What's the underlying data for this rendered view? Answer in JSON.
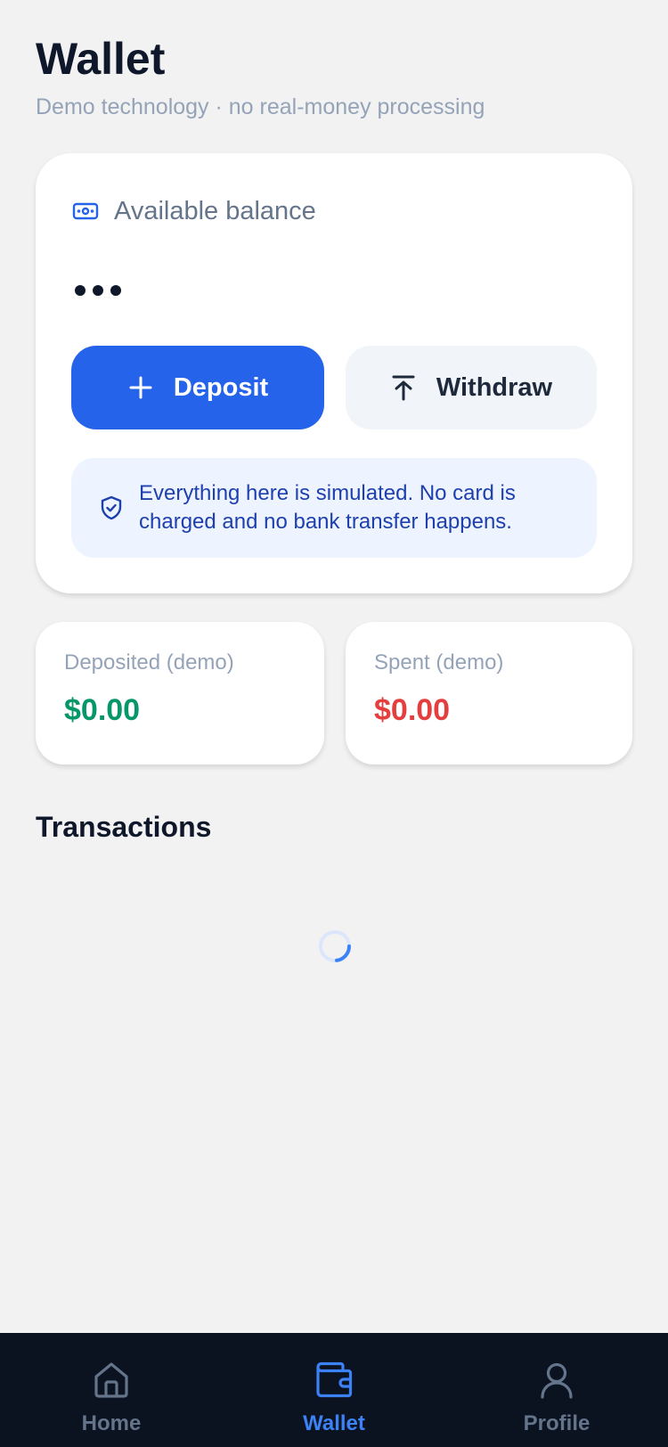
{
  "header": {
    "title": "Wallet",
    "subtitle": "Demo technology · no real-money processing"
  },
  "balance": {
    "label": "Available balance",
    "icon": "cash-icon",
    "value_state": "loading"
  },
  "actions": {
    "deposit_label": "Deposit",
    "withdraw_label": "Withdraw"
  },
  "notice": {
    "icon": "shield-check-icon",
    "text": "Everything here is simulated. No card is charged and no bank transfer happens."
  },
  "stats": {
    "deposited_label": "Deposited (demo)",
    "deposited_value": "$0.00",
    "spent_label": "Spent (demo)",
    "spent_value": "$0.00"
  },
  "transactions": {
    "title": "Transactions",
    "state": "loading"
  },
  "nav": {
    "items": [
      {
        "label": "Home",
        "icon": "home-icon",
        "active": false
      },
      {
        "label": "Wallet",
        "icon": "wallet-icon",
        "active": true
      },
      {
        "label": "Profile",
        "icon": "profile-icon",
        "active": false
      }
    ]
  },
  "colors": {
    "accent": "#2563eb",
    "deposited": "#059669",
    "spent": "#e53e3e",
    "nav_bg": "#0b1220"
  }
}
